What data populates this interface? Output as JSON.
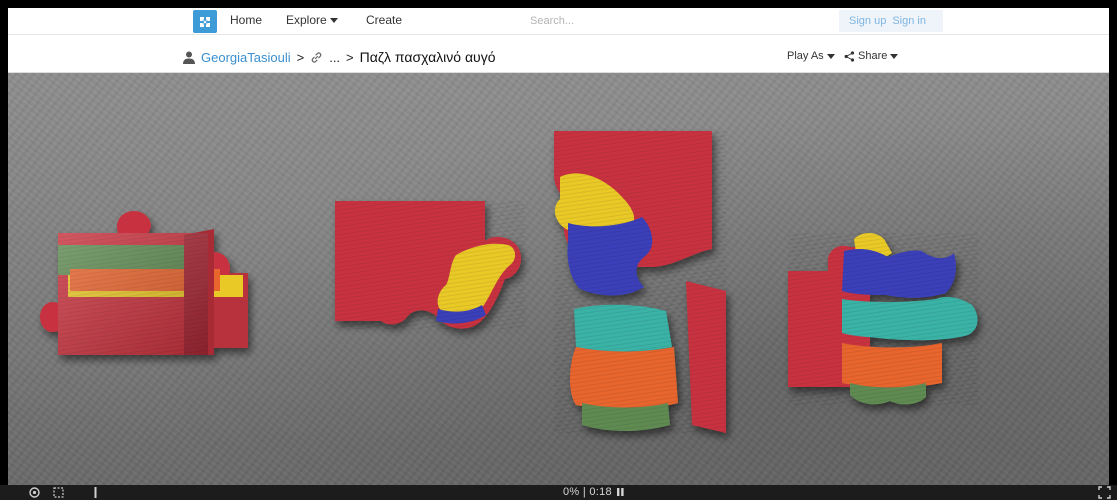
{
  "topnav": {
    "home": "Home",
    "explore": "Explore",
    "create": "Create",
    "search_placeholder": "Search...",
    "signup": "Sign up",
    "signin": "Sign in"
  },
  "breadcrumb": {
    "user": "GeorgiaTasiouli",
    "sep1": ">",
    "ellipsis": "...",
    "sep2": ">",
    "title": "Παζλ πασχαλινό αυγό"
  },
  "subnav": {
    "play_as": "Play As",
    "share": "Share"
  },
  "bottombar": {
    "status": "0% | 0:18"
  },
  "colors": {
    "red": "#c8333f",
    "yellow": "#e9c928",
    "blue": "#3b3fb9",
    "teal": "#3bb2a6",
    "orange": "#e8652f",
    "green": "#5f8b52",
    "link": "#3a8fd0",
    "logo": "#3d9bd8"
  }
}
